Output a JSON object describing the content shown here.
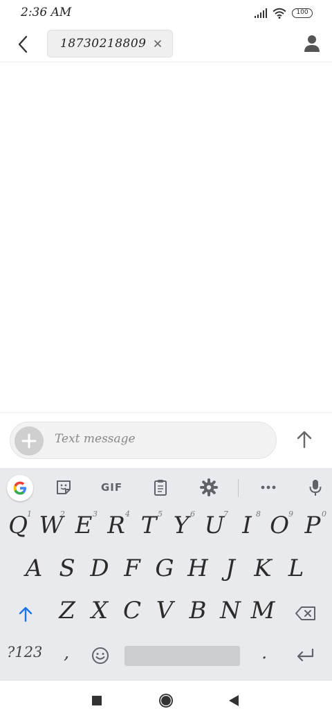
{
  "status_bar": {
    "time": "2:36 AM",
    "battery": "100",
    "icons": [
      "signal-icon",
      "wifi-icon",
      "battery-icon"
    ]
  },
  "header": {
    "back_icon": "back-arrow-icon",
    "recipient": "18730218809",
    "remove_icon": "close-icon",
    "contact_icon": "person-icon"
  },
  "compose": {
    "placeholder": "Text message",
    "add_icon": "plus-icon",
    "send_icon": "arrow-up-icon"
  },
  "keyboard": {
    "toolbar": {
      "gif_label": "GIF",
      "icons": [
        "google-icon",
        "sticker-icon",
        "clipboard-icon",
        "gear-icon",
        "more-icon",
        "microphone-icon"
      ]
    },
    "row1": [
      {
        "key": "Q",
        "hint": "1"
      },
      {
        "key": "W",
        "hint": "2"
      },
      {
        "key": "E",
        "hint": "3"
      },
      {
        "key": "R",
        "hint": "4"
      },
      {
        "key": "T",
        "hint": "5"
      },
      {
        "key": "Y",
        "hint": "6"
      },
      {
        "key": "U",
        "hint": "7"
      },
      {
        "key": "I",
        "hint": "8"
      },
      {
        "key": "O",
        "hint": "9"
      },
      {
        "key": "P",
        "hint": "0"
      }
    ],
    "row2": [
      "A",
      "S",
      "D",
      "F",
      "G",
      "H",
      "J",
      "K",
      "L"
    ],
    "row3": [
      "Z",
      "X",
      "C",
      "V",
      "B",
      "N",
      "M"
    ],
    "symbols_label": "?123",
    "comma": ",",
    "period": ".",
    "accent_color": "#1a73e8"
  },
  "nav_bar": {
    "icons": [
      "recents-square-icon",
      "home-circle-icon",
      "back-triangle-icon"
    ]
  }
}
